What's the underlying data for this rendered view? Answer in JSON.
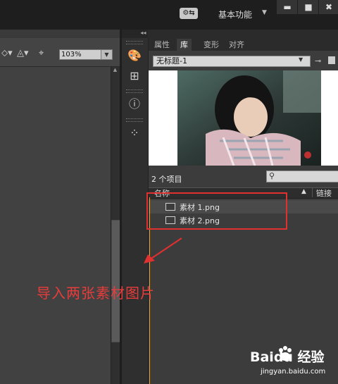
{
  "titlebar": {
    "workspace_label": "基本功能",
    "minimize": "▬",
    "maximize": "■",
    "close": "✖"
  },
  "options_bar": {
    "zoom": "103%"
  },
  "library_panel": {
    "tabs": [
      {
        "label": "属性",
        "active": false
      },
      {
        "label": "库",
        "active": true
      },
      {
        "label": "变形",
        "active": false
      },
      {
        "label": "对齐",
        "active": false
      }
    ],
    "document": "无标题-1",
    "item_count": "2 个项目",
    "columns": {
      "name": "名称",
      "link": "链接"
    },
    "items": [
      {
        "label": "素材 1.png"
      },
      {
        "label": "素材 2.png"
      }
    ]
  },
  "annotation": {
    "caption": "导入两张素材图片",
    "color": "#e03030"
  },
  "watermark": {
    "logo": "Baidu 经验",
    "url": "jingyan.baidu.com"
  }
}
